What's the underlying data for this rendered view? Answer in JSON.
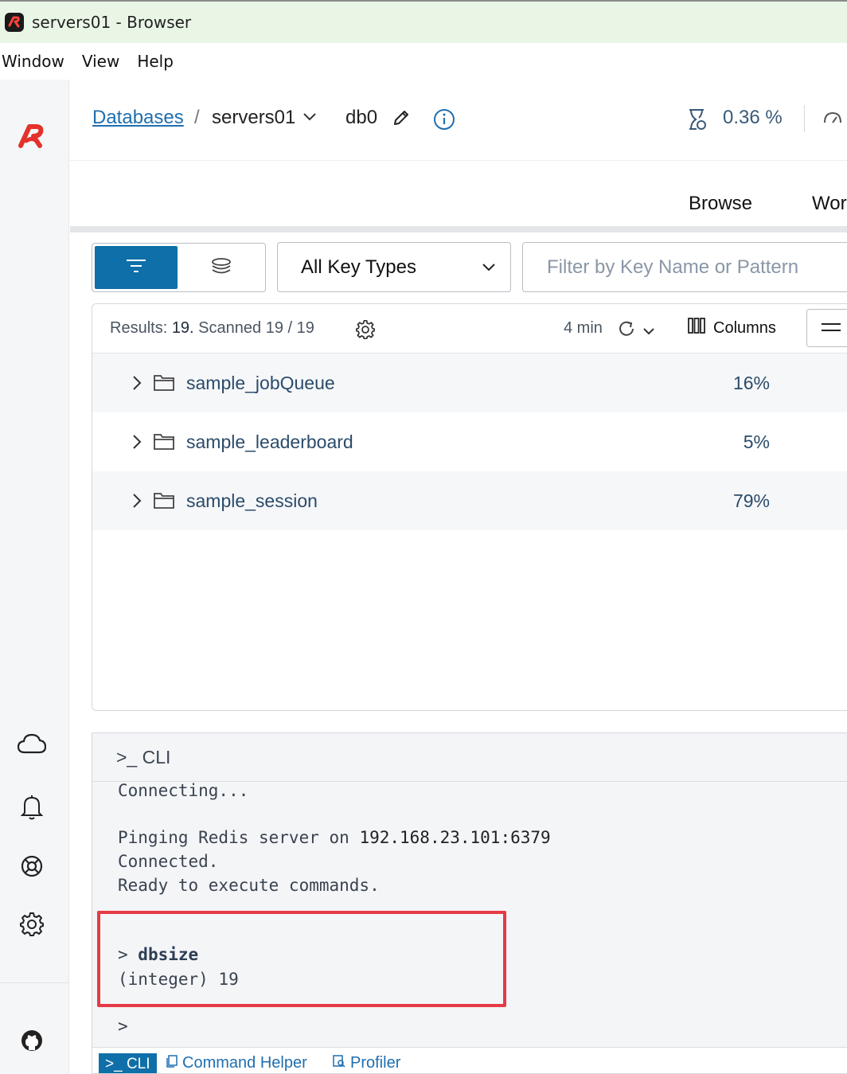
{
  "window": {
    "title": "servers01 - Browser"
  },
  "menu": [
    {
      "label": "Window"
    },
    {
      "label": "View"
    },
    {
      "label": "Help"
    }
  ],
  "breadcrumb": {
    "databases_label": "Databases",
    "separator": "/",
    "database_name": "servers01",
    "db_index": "db0"
  },
  "metrics": {
    "cpu": "0.36 %"
  },
  "tabs": {
    "browse": "Browse",
    "workbench_partial": "Wor"
  },
  "filters": {
    "key_type_label": "All Key Types",
    "search_placeholder": "Filter by Key Name or Pattern",
    "search_value": ""
  },
  "results": {
    "summary_prefix": "Results: ",
    "summary_count": "19.",
    "summary_scanned": " Scanned 19 / 19",
    "refresh_age": "4 min",
    "columns_label": "Columns",
    "rows": [
      {
        "name": "sample_jobQueue",
        "percent": "16%"
      },
      {
        "name": "sample_leaderboard",
        "percent": "5%"
      },
      {
        "name": "sample_session",
        "percent": "79%"
      }
    ]
  },
  "cli": {
    "title": ">_ CLI",
    "lines": {
      "connecting": "Connecting...",
      "pinging": "Pinging Redis server on ",
      "address": "192.168.23.101:6379",
      "connected": "Connected.",
      "ready": "Ready to execute commands."
    },
    "command_prompt": "> ",
    "command": "dbsize",
    "command_result": "(integer) 19",
    "prompt": ">",
    "footer": {
      "cli_tab": ">_ CLI",
      "command_helper": "Command Helper",
      "profiler": "Profiler"
    }
  },
  "colors": {
    "accent": "#0f6fa8",
    "highlight": "#e53a45",
    "link": "#1f6fb0",
    "titlebar": "#e9f6e6"
  },
  "icons": [
    "redis-logo-icon",
    "cloud-icon",
    "bell-icon",
    "help-lifebuoy-icon",
    "gear-icon",
    "github-icon",
    "pencil-icon",
    "info-icon",
    "cpu-icon",
    "gauge-icon",
    "filter-icon",
    "stack-icon",
    "chevron-down-icon",
    "refresh-icon",
    "columns-icon",
    "folder-icon",
    "chevron-right-icon"
  ]
}
